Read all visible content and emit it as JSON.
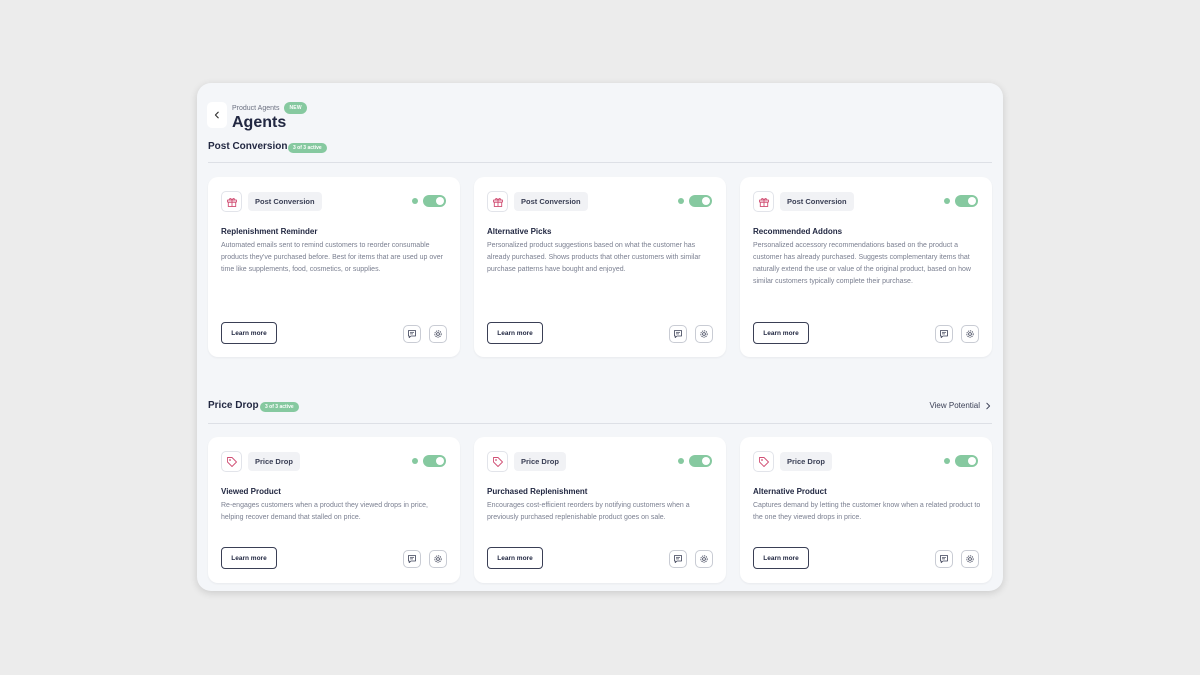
{
  "header": {
    "breadcrumb": "Product Agents",
    "new_badge": "NEW",
    "title": "Agents"
  },
  "sections": [
    {
      "title": "Post Conversion",
      "badge": "3 of 3 active",
      "cards": [
        {
          "tag": "Post Conversion",
          "type_icon": "gift-icon",
          "active": true,
          "title": "Replenishment Reminder",
          "description": "Automated emails sent to remind customers to reorder consumable products they've purchased before. Best for items that are used up over time like supplements, food, cosmetics, or supplies.",
          "learn_more": "Learn more"
        },
        {
          "tag": "Post Conversion",
          "type_icon": "gift-icon",
          "active": true,
          "title": "Alternative Picks",
          "description": "Personalized product suggestions based on what the customer has already purchased. Shows products that other customers with similar purchase patterns have bought and enjoyed.",
          "learn_more": "Learn more"
        },
        {
          "tag": "Post Conversion",
          "type_icon": "gift-icon",
          "active": true,
          "title": "Recommended Addons",
          "description": "Personalized accessory recommendations based on the product a customer has already purchased. Suggests complementary items that naturally extend the use or value of the original product, based on how similar customers typically complete their purchase.",
          "learn_more": "Learn more"
        }
      ]
    },
    {
      "title": "Price Drop",
      "badge": "3 of 3 active",
      "view_potential": "View Potential",
      "cards": [
        {
          "tag": "Price Drop",
          "type_icon": "price-tag-icon",
          "active": true,
          "title": "Viewed Product",
          "description": "Re-engages customers when a product they viewed drops in price, helping recover demand that stalled on price.",
          "learn_more": "Learn more"
        },
        {
          "tag": "Price Drop",
          "type_icon": "price-tag-icon",
          "active": true,
          "title": "Purchased Replenishment",
          "description": "Encourages cost-efficient reorders by notifying customers when a previously purchased replenishable product goes on sale.",
          "learn_more": "Learn more"
        },
        {
          "tag": "Price Drop",
          "type_icon": "price-tag-icon",
          "active": true,
          "title": "Alternative Product",
          "description": "Captures demand by letting the customer know when a related product to the one they viewed drops in price.",
          "learn_more": "Learn more"
        }
      ]
    }
  ],
  "colors": {
    "accent_green": "#86c9a0",
    "icon_pink": "#d14f74",
    "panel_bg": "#f4f6f9",
    "page_bg": "#ececec"
  }
}
